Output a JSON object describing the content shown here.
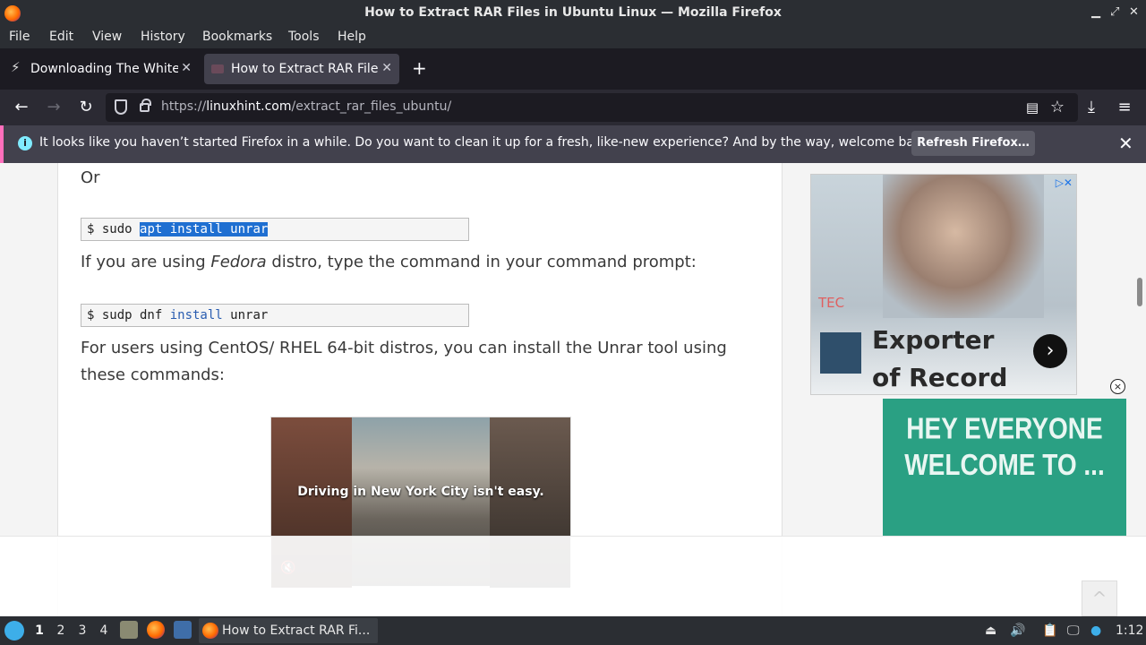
{
  "window": {
    "title": "How to Extract RAR Files in Ubuntu Linux — Mozilla Firefox"
  },
  "menu": [
    "File",
    "Edit",
    "View",
    "History",
    "Bookmarks",
    "Tools",
    "Help"
  ],
  "tabs": [
    {
      "label": "Downloading The White House",
      "active": false
    },
    {
      "label": "How to Extract RAR Files in Ubuntu Linux",
      "active": true
    }
  ],
  "nav": {
    "url_prefix": "https://",
    "url_domain": "linuxhint.com",
    "url_path": "/extract_rar_files_ubuntu/"
  },
  "notification": {
    "message": "It looks like you haven’t started Firefox in a while. Do you want to clean it up for a fresh, like-new experience? And by the way, welcome back!",
    "button": "Refresh Firefox…"
  },
  "article": {
    "or_text": "Or",
    "code1_prompt": "$ sudo ",
    "code1_selected": "apt install unrar",
    "para1_before": "If you are using ",
    "para1_em": "Fedora",
    "para1_after": " distro, type the command in your command prompt:",
    "code2_prompt": "$ sudp dnf ",
    "code2_kw": "install",
    "code2_rest": " unrar",
    "para2": "For users using CentOS/ RHEL 64-bit distros, you can install the Unrar tool using these commands:"
  },
  "ads": {
    "video_caption": "Driving in New York City isn't easy.",
    "side1_headline": "Exporter of Record",
    "side1_logo": "TEC",
    "side2_text": "HEY EVERYONE WELCOME TO ..."
  },
  "taskbar": {
    "workspaces": [
      "1",
      "2",
      "3",
      "4"
    ],
    "active_workspace": "1",
    "task_label": "How to Extract RAR Fi...",
    "clock": "1:12"
  }
}
